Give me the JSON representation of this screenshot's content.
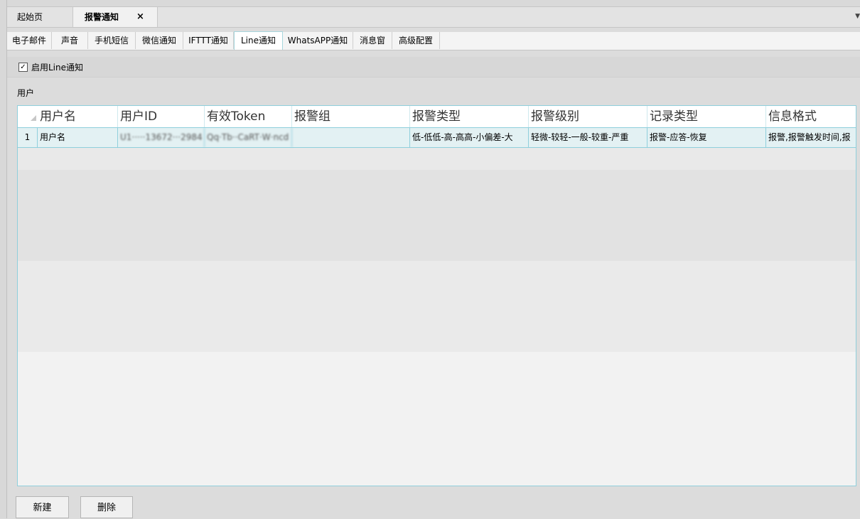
{
  "doc_tabs": {
    "start_label": "起始页",
    "active_label": "报警通知",
    "close_symbol": "×"
  },
  "sub_tabs": [
    "电子邮件",
    "声音",
    "手机短信",
    "微信通知",
    "IFTTT通知",
    "Line通知",
    "WhatsAPP通知",
    "消息窗",
    "高级配置"
  ],
  "active_sub_tab": "Line通知",
  "enable_checkbox": {
    "checked": true,
    "label": "启用Line通知"
  },
  "users_label": "用户",
  "table": {
    "columns": [
      "用户名",
      "用户ID",
      "有效Token",
      "报警组",
      "报警类型",
      "报警级别",
      "记录类型",
      "信息格式"
    ],
    "rows": [
      {
        "index": "1",
        "user_name": "用户名",
        "user_id": "U1·····13672···2984",
        "token": "Qq·Tb··CaRT·W·ncd",
        "alarm_group": "",
        "alarm_type": "低-低低-高-高高-小偏差-大",
        "alarm_level": "轻微-较轻-一般-较重-严重",
        "record_type": "报警-应答-恢复",
        "message_format": "报警,报警触发时间,报"
      }
    ]
  },
  "buttons": {
    "new_label": "新建",
    "delete_label": "删除"
  }
}
